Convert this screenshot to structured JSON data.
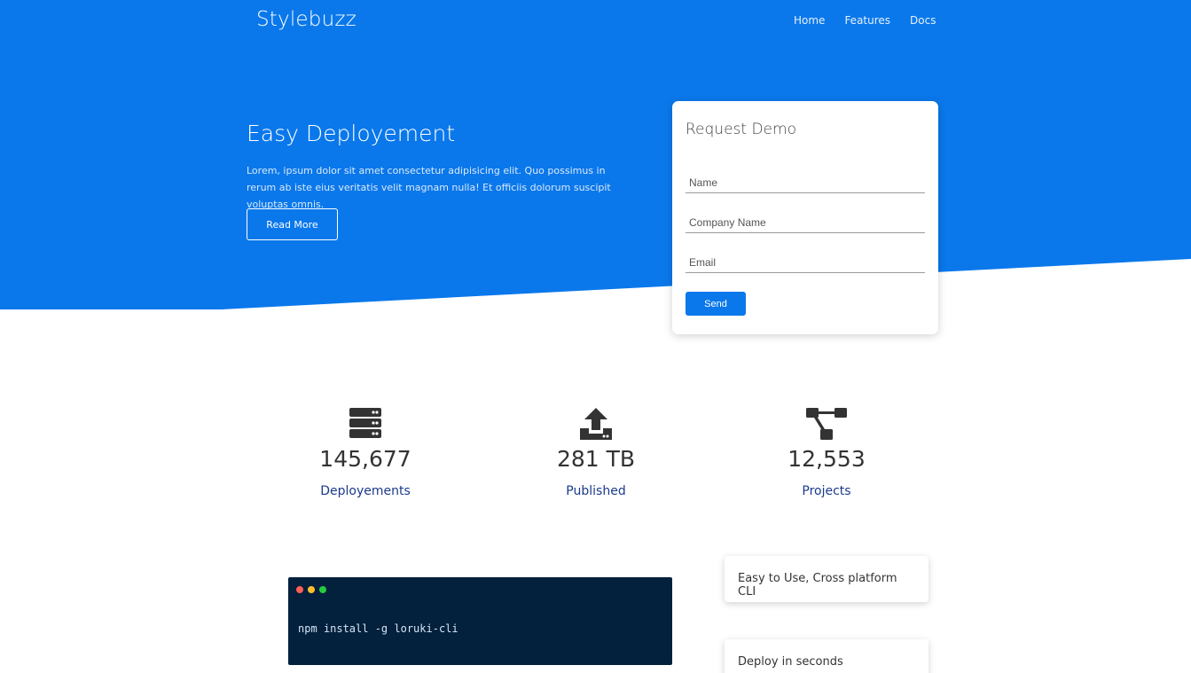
{
  "header": {
    "brand": "Stylebuzz",
    "nav": [
      "Home",
      "Features",
      "Docs"
    ]
  },
  "hero": {
    "title": "Easy Deployement",
    "text": "Lorem, ipsum dolor sit amet consectetur adipisicing elit. Quo possimus in rerum ab iste eius veritatis velit magnam nulla! Et officiis dolorum suscipit voluptas omnis.",
    "button_label": "Read More"
  },
  "demo_form": {
    "title": "Request Demo",
    "name_placeholder": "Name",
    "company_placeholder": "Company Name",
    "email_placeholder": "Email",
    "send_label": "Send"
  },
  "stats": [
    {
      "icon": "server-icon",
      "value": "145,677",
      "label": "Deployements"
    },
    {
      "icon": "upload-icon",
      "value": "281 TB",
      "label": "Published"
    },
    {
      "icon": "project-diagram-icon",
      "value": "12,553",
      "label": "Projects"
    }
  ],
  "terminal": {
    "command": "npm install -g loruki-cli",
    "dot_colors": [
      "#ff5f56",
      "#ffbd2e",
      "#27c93f"
    ]
  },
  "features": [
    "Easy to Use, Cross platform CLI",
    "Deploy in seconds"
  ],
  "colors": {
    "primary": "#0a78eb",
    "terminal_bg": "#03203c",
    "stat_label": "#1b3a8c"
  }
}
